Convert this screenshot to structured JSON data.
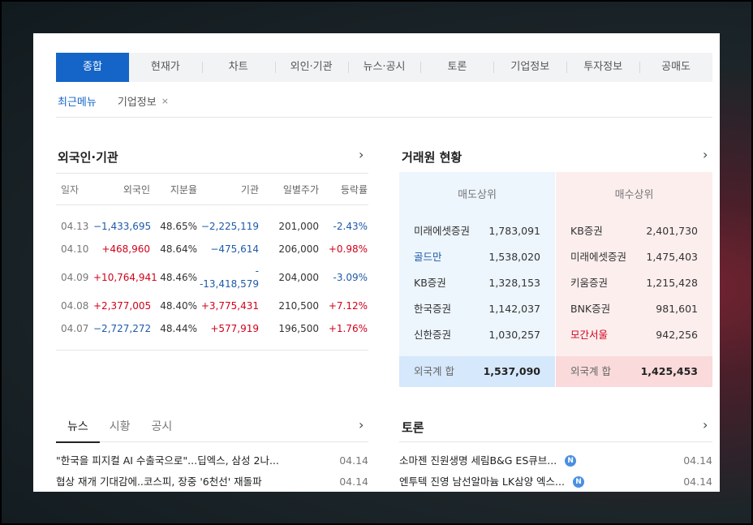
{
  "tabs": [
    "종합",
    "현재가",
    "차트",
    "외인·기관",
    "뉴스·공시",
    "토론",
    "기업정보",
    "투자정보",
    "공매도"
  ],
  "active_tab": 0,
  "recent": {
    "label": "최근메뉴",
    "item": "기업정보",
    "close": "×"
  },
  "foreign": {
    "title": "외국인·기관",
    "chevron": "›",
    "headers": [
      "일자",
      "외국인",
      "지분율",
      "기관",
      "일별주가",
      "등락률"
    ],
    "rows": [
      {
        "date": "04.13",
        "foreign": "−1,433,695",
        "fdir": "down",
        "ratio": "48.65%",
        "inst": "−2,225,119",
        "idir": "down",
        "price": "201,000",
        "change": "-2.43%",
        "cdir": "down"
      },
      {
        "date": "04.10",
        "foreign": "+468,960",
        "fdir": "up",
        "ratio": "48.64%",
        "inst": "−475,614",
        "idir": "down",
        "price": "206,000",
        "change": "+0.98%",
        "cdir": "up"
      },
      {
        "date": "04.09",
        "foreign": "+10,764,941",
        "fdir": "up",
        "ratio": "48.46%",
        "inst": "-13,418,579",
        "idir": "down",
        "price": "204,000",
        "change": "-3.09%",
        "cdir": "down"
      },
      {
        "date": "04.08",
        "foreign": "+2,377,005",
        "fdir": "up",
        "ratio": "48.40%",
        "inst": "+3,775,431",
        "idir": "up",
        "price": "210,500",
        "change": "+7.12%",
        "cdir": "up"
      },
      {
        "date": "04.07",
        "foreign": "−2,727,272",
        "fdir": "down",
        "ratio": "48.44%",
        "inst": "+577,919",
        "idir": "up",
        "price": "196,500",
        "change": "+1.76%",
        "cdir": "up"
      }
    ]
  },
  "broker": {
    "title": "거래원 현황",
    "chevron": "›",
    "sell_header": "매도상위",
    "buy_header": "매수상위",
    "sell": [
      {
        "name": "미래에셋증권",
        "value": "1,783,091",
        "color": ""
      },
      {
        "name": "골드만",
        "value": "1,538,020",
        "color": "blue"
      },
      {
        "name": "KB증권",
        "value": "1,328,153",
        "color": ""
      },
      {
        "name": "한국증권",
        "value": "1,142,037",
        "color": ""
      },
      {
        "name": "신한증권",
        "value": "1,030,257",
        "color": ""
      }
    ],
    "buy": [
      {
        "name": "KB증권",
        "value": "2,401,730",
        "color": ""
      },
      {
        "name": "미래에셋증권",
        "value": "1,475,403",
        "color": ""
      },
      {
        "name": "키움증권",
        "value": "1,215,428",
        "color": ""
      },
      {
        "name": "BNK증권",
        "value": "981,601",
        "color": ""
      },
      {
        "name": "모간서울",
        "value": "942,256",
        "color": "red"
      }
    ],
    "sell_total_label": "외국계 합",
    "sell_total": "1,537,090",
    "buy_total_label": "외국계 합",
    "buy_total": "1,425,453"
  },
  "news": {
    "tabs": [
      "뉴스",
      "시황",
      "공시"
    ],
    "chevron": "›",
    "items": [
      {
        "title": "\"한국을 피지컬 AI 수출국으로\"...딥엑스, 삼성 2나...",
        "date": "04.14"
      },
      {
        "title": "협상 재개 기대감에..코스피, 장중 '6천선' 재돌파",
        "date": "04.14"
      }
    ]
  },
  "discussion": {
    "title": "토론",
    "chevron": "›",
    "badge": "N",
    "items": [
      {
        "title": "소마젠 진원생명 세림B&G ES큐브...",
        "date": "04.14"
      },
      {
        "title": "엔투텍 진영 남선알마늄 LK삼양 엑스...",
        "date": "04.14"
      }
    ]
  },
  "colors": {
    "accent": "#1565c8",
    "up": "#d0021b",
    "down": "#1e5aa8"
  }
}
